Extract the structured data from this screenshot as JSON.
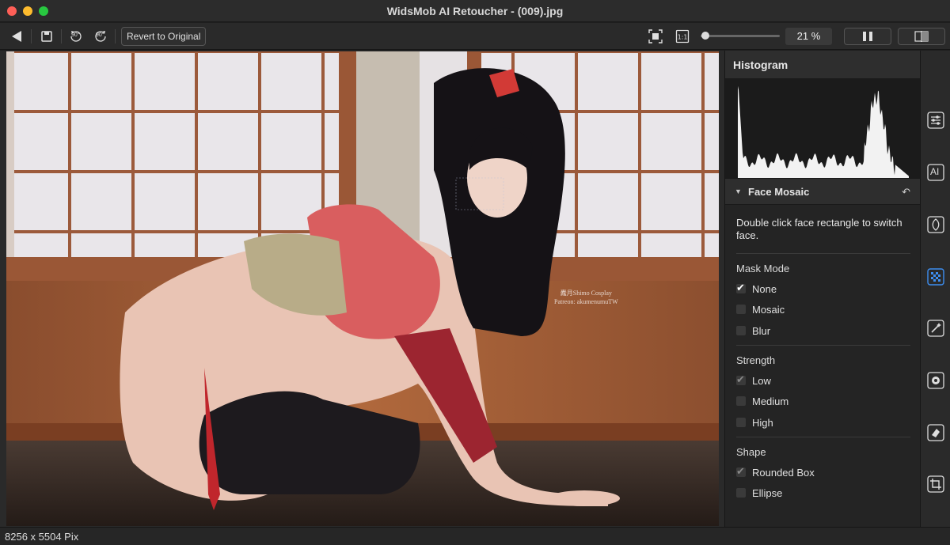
{
  "window": {
    "title": "WidsMob AI Retoucher - (009).jpg"
  },
  "toolbar": {
    "back_icon": "back-triangle-icon",
    "save_icon": "save-icon",
    "rotate_left_label": "90°",
    "rotate_right_label": "90°",
    "revert_label": "Revert to Original",
    "zoom_level": "21 %",
    "zoom_slider_fraction": 0.04
  },
  "photo": {
    "watermark_line1": "蠹月Shimo Cosplay",
    "watermark_line2": "Patreon: akumenumuTW"
  },
  "histogram": {
    "title": "Histogram"
  },
  "face_mosaic": {
    "title": "Face Mosaic",
    "description": "Double click face rectangle to switch face.",
    "mask_mode": {
      "label": "Mask Mode",
      "options": [
        {
          "label": "None",
          "checked": true
        },
        {
          "label": "Mosaic",
          "checked": false
        },
        {
          "label": "Blur",
          "checked": false
        }
      ]
    },
    "strength": {
      "label": "Strength",
      "options": [
        {
          "label": "Low",
          "checked": true
        },
        {
          "label": "Medium",
          "checked": false
        },
        {
          "label": "High",
          "checked": false
        }
      ]
    },
    "shape": {
      "label": "Shape",
      "options": [
        {
          "label": "Rounded Box",
          "checked": true
        },
        {
          "label": "Ellipse",
          "checked": false
        }
      ]
    }
  },
  "rail": {
    "icons": [
      "adjustments-icon",
      "ai-icon",
      "skin-icon",
      "face-mosaic-icon",
      "magic-wand-icon",
      "settings-icon",
      "eraser-icon",
      "crop-icon"
    ],
    "ai_label": "AI"
  },
  "status": {
    "dimensions": "8256 x 5504 Pix"
  },
  "colors": {
    "active_icon": "#3d8ef0",
    "panel_bg": "#242424",
    "accent_close": "#fe5f57"
  }
}
